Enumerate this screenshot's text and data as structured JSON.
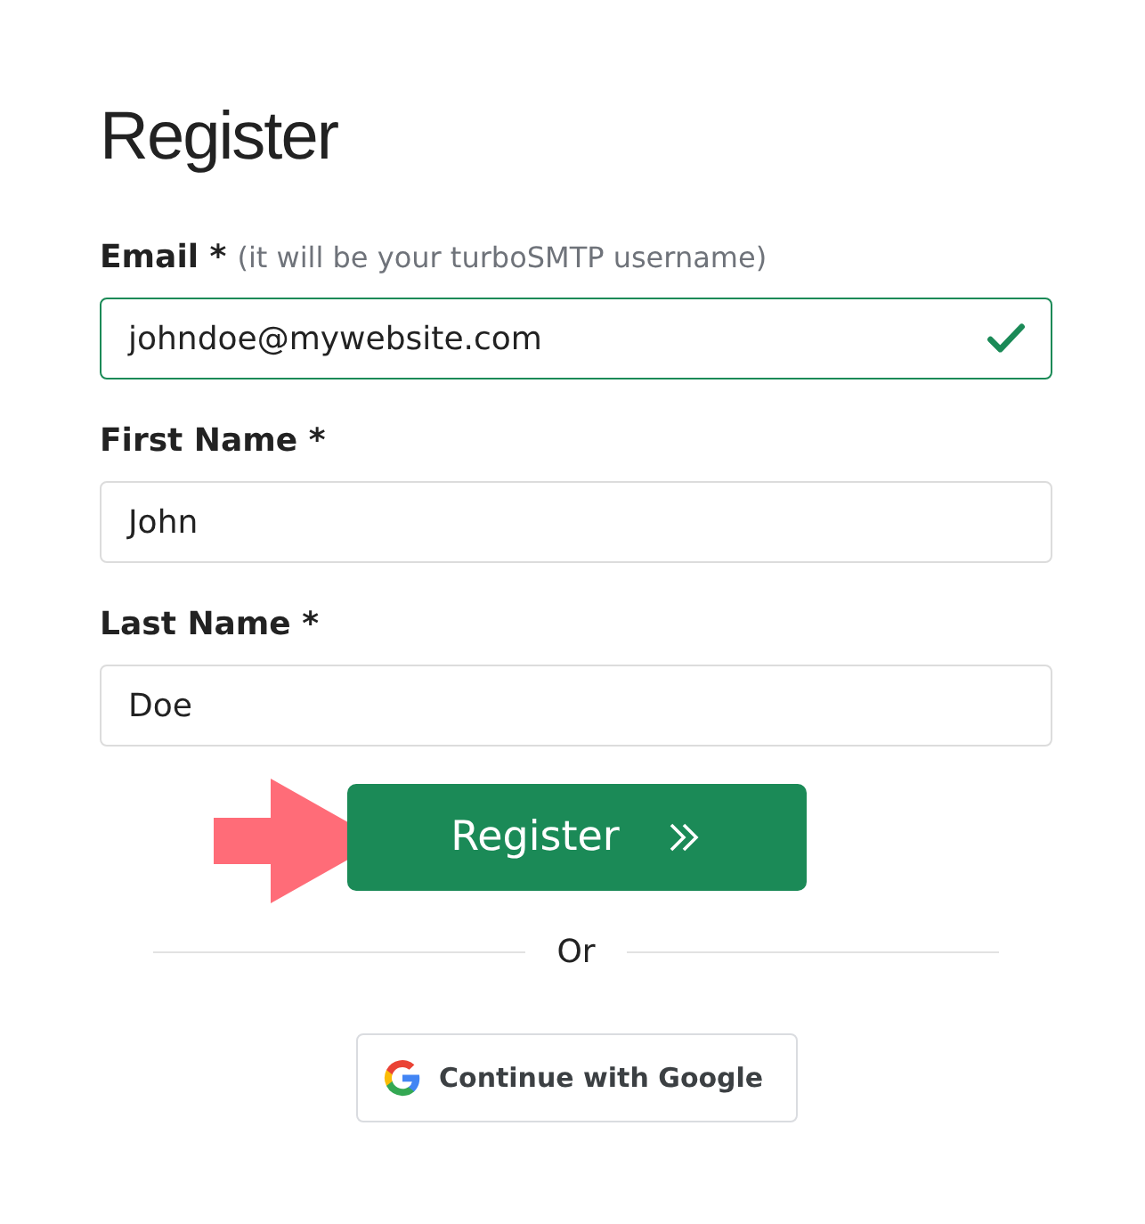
{
  "title": "Register",
  "fields": [
    {
      "label": "Email *",
      "hint": "(it will be your turboSMTP username)",
      "value": "johndoe@mywebsite.com",
      "valid": true
    },
    {
      "label": "First Name *",
      "value": "John",
      "valid": false
    },
    {
      "label": "Last Name *",
      "value": "Doe",
      "valid": false
    }
  ],
  "submit_button": "Register",
  "divider_text": "Or",
  "google_button": "Continue with Google"
}
